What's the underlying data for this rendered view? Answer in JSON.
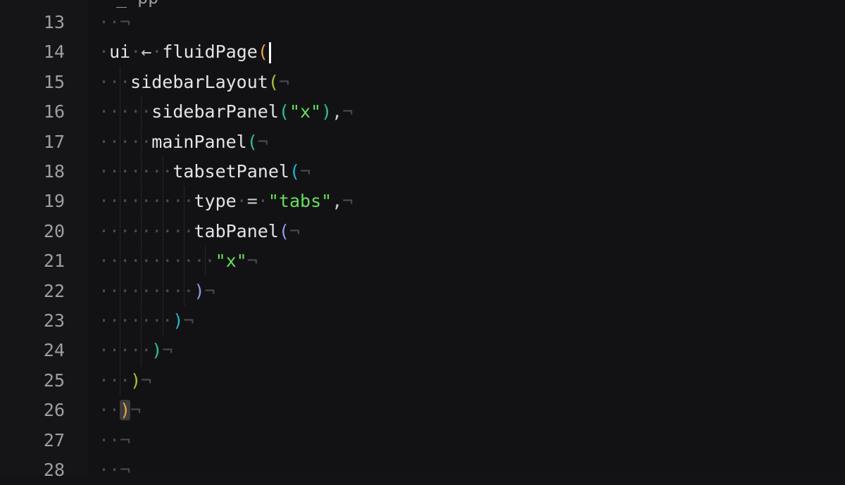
{
  "editor": {
    "line_numbers": [
      "13",
      "14",
      "15",
      "16",
      "17",
      "18",
      "19",
      "20",
      "21",
      "22",
      "23",
      "24",
      "25",
      "26",
      "27",
      "28"
    ],
    "top_fragment": "_ pp",
    "lines": [
      {
        "tokens": [
          {
            "c": "ws",
            "t": "··"
          },
          {
            "c": "nl",
            "t": "¬"
          }
        ]
      },
      {
        "tokens": [
          {
            "c": "ws",
            "t": "·"
          },
          {
            "c": "id",
            "t": "ui"
          },
          {
            "c": "ws",
            "t": "·"
          },
          {
            "c": "arrow",
            "t": "←"
          },
          {
            "c": "ws",
            "t": "·"
          },
          {
            "c": "id",
            "t": "fluidPage"
          },
          {
            "c": "p1",
            "t": "("
          }
        ]
      },
      {
        "tokens": [
          {
            "c": "ws",
            "t": "···"
          },
          {
            "c": "id",
            "t": "sidebarLayout"
          },
          {
            "c": "p2",
            "t": "("
          },
          {
            "c": "nl",
            "t": "¬"
          }
        ]
      },
      {
        "tokens": [
          {
            "c": "ws",
            "t": "·····"
          },
          {
            "c": "id",
            "t": "sidebarPanel"
          },
          {
            "c": "p3",
            "t": "("
          },
          {
            "c": "str",
            "t": "\"x\""
          },
          {
            "c": "p3",
            "t": ")"
          },
          {
            "c": "op",
            "t": ","
          },
          {
            "c": "nl",
            "t": "¬"
          }
        ]
      },
      {
        "tokens": [
          {
            "c": "ws",
            "t": "·····"
          },
          {
            "c": "id",
            "t": "mainPanel"
          },
          {
            "c": "p3",
            "t": "("
          },
          {
            "c": "nl",
            "t": "¬"
          }
        ]
      },
      {
        "tokens": [
          {
            "c": "ws",
            "t": "·······"
          },
          {
            "c": "id",
            "t": "tabsetPanel"
          },
          {
            "c": "p4",
            "t": "("
          },
          {
            "c": "nl",
            "t": "¬"
          }
        ]
      },
      {
        "tokens": [
          {
            "c": "ws",
            "t": "·········"
          },
          {
            "c": "id",
            "t": "type"
          },
          {
            "c": "ws",
            "t": "·"
          },
          {
            "c": "op",
            "t": "="
          },
          {
            "c": "ws",
            "t": "·"
          },
          {
            "c": "str",
            "t": "\"tabs\""
          },
          {
            "c": "op",
            "t": ","
          },
          {
            "c": "nl",
            "t": "¬"
          }
        ]
      },
      {
        "tokens": [
          {
            "c": "ws",
            "t": "·········"
          },
          {
            "c": "id",
            "t": "tabPanel"
          },
          {
            "c": "p5",
            "t": "("
          },
          {
            "c": "nl",
            "t": "¬"
          }
        ]
      },
      {
        "tokens": [
          {
            "c": "ws",
            "t": "···········"
          },
          {
            "c": "str",
            "t": "\"x\""
          },
          {
            "c": "nl",
            "t": "¬"
          }
        ]
      },
      {
        "tokens": [
          {
            "c": "ws",
            "t": "·········"
          },
          {
            "c": "p5",
            "t": ")"
          },
          {
            "c": "nl",
            "t": "¬"
          }
        ]
      },
      {
        "tokens": [
          {
            "c": "ws",
            "t": "·······"
          },
          {
            "c": "p4",
            "t": ")"
          },
          {
            "c": "nl",
            "t": "¬"
          }
        ]
      },
      {
        "tokens": [
          {
            "c": "ws",
            "t": "·····"
          },
          {
            "c": "p3",
            "t": ")"
          },
          {
            "c": "nl",
            "t": "¬"
          }
        ]
      },
      {
        "tokens": [
          {
            "c": "ws",
            "t": "···"
          },
          {
            "c": "p2",
            "t": ")"
          },
          {
            "c": "nl",
            "t": "¬"
          }
        ]
      },
      {
        "tokens": [
          {
            "c": "ws",
            "t": "··"
          },
          {
            "c": "p1 hl",
            "t": ")"
          },
          {
            "c": "nl",
            "t": "¬"
          }
        ]
      },
      {
        "tokens": [
          {
            "c": "ws",
            "t": "··"
          },
          {
            "c": "nl",
            "t": "¬"
          }
        ]
      },
      {
        "tokens": [
          {
            "c": "ws",
            "t": "··"
          },
          {
            "c": "nl",
            "t": "¬"
          }
        ]
      }
    ]
  },
  "colors": {
    "background": "#131316",
    "string": "#66e05a",
    "paren_level_1": "#e8a440",
    "paren_level_2": "#a4c838",
    "paren_level_3": "#2cc38d",
    "paren_level_4": "#22b5cc",
    "paren_level_5": "#8a9cf0"
  }
}
